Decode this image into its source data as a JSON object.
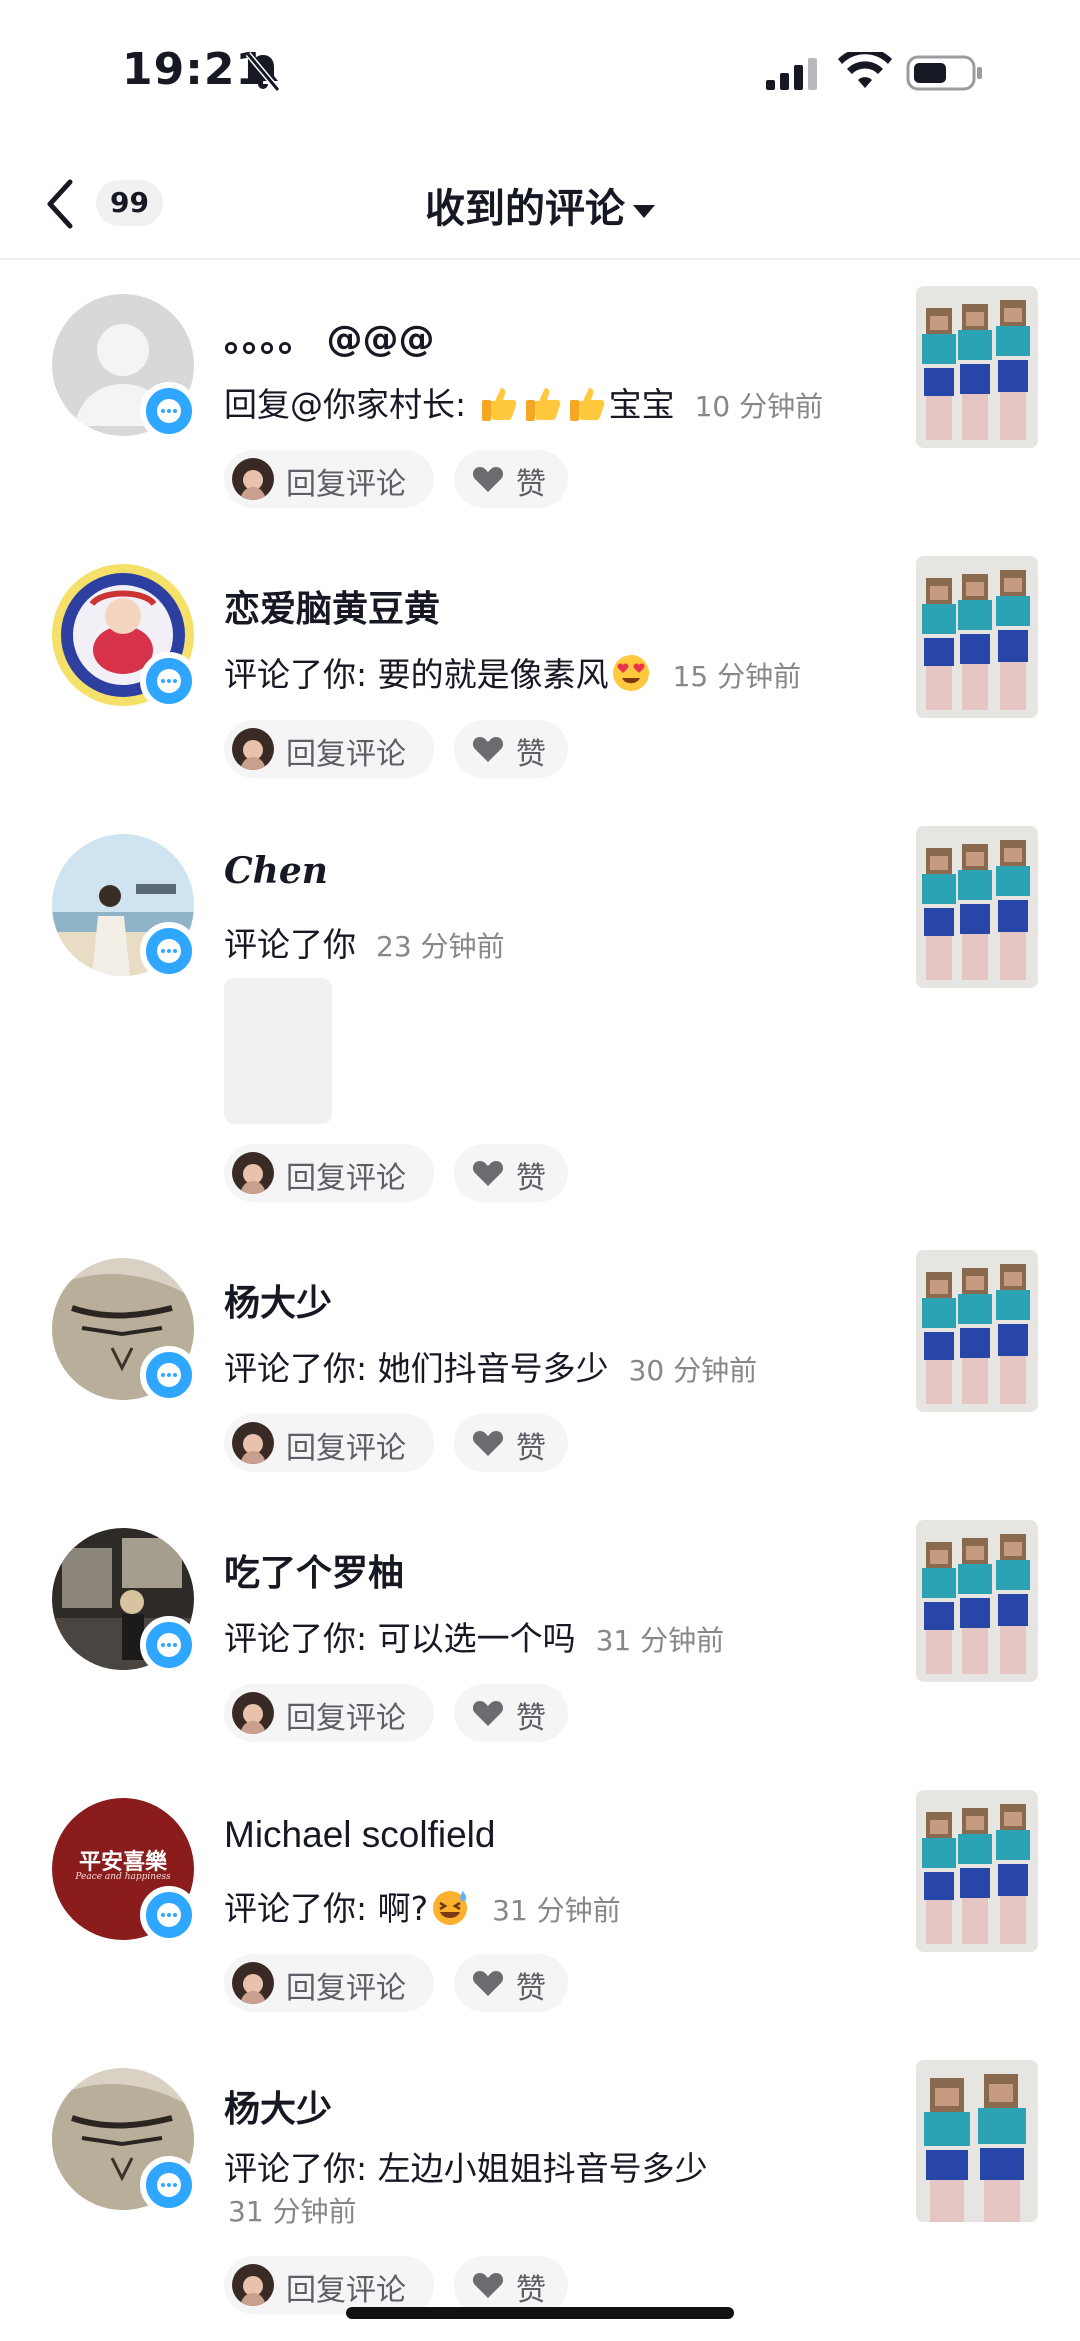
{
  "status_bar": {
    "time": "19:21",
    "icons": [
      "bell-slash-icon",
      "cellular-signal-icon",
      "wifi-icon",
      "battery-icon"
    ]
  },
  "nav": {
    "back_icon": "chevron-left-icon",
    "unread_count": "99",
    "title": "收到的评论",
    "title_caret_icon": "caret-down-icon"
  },
  "actions": {
    "reply_label": "回复评论",
    "like_label": "赞"
  },
  "comments": [
    {
      "username": "。。。。 @@@",
      "prefix": "回复@你家村长: ",
      "emoji": [
        "thumbs-up-emoji",
        "thumbs-up-emoji",
        "thumbs-up-emoji"
      ],
      "text_after_emoji": "宝宝",
      "time_ago": "10 分钟前"
    },
    {
      "username": "恋爱脑黄豆黄",
      "prefix": "评论了你: 要的就是像素风",
      "emoji": [
        "heart-eyes-emoji"
      ],
      "time_ago": "15 分钟前"
    },
    {
      "username": "Chen",
      "prefix": "评论了你",
      "time_ago": "23 分钟前",
      "has_media": true
    },
    {
      "username": "杨大少",
      "prefix": "评论了你: 她们抖音号多少",
      "time_ago": "30 分钟前"
    },
    {
      "username": "吃了个罗柚",
      "prefix": "评论了你: 可以选一个吗",
      "time_ago": "31 分钟前"
    },
    {
      "username": "Michael scolfield",
      "prefix": "评论了你: 啊?",
      "emoji": [
        "grinning-sweat-emoji"
      ],
      "time_ago": "31 分钟前",
      "avatar_text": "平安喜樂",
      "avatar_subtext": "Peace and happiness"
    },
    {
      "username": "杨大少",
      "prefix": "评论了你: 左边小姐姐抖音号多少",
      "time_ago": "31 分钟前"
    }
  ],
  "colors": {
    "accent_badge": "#2fa6ff",
    "secondary_text": "#86878b",
    "pill_bg": "#f5f5f6"
  }
}
